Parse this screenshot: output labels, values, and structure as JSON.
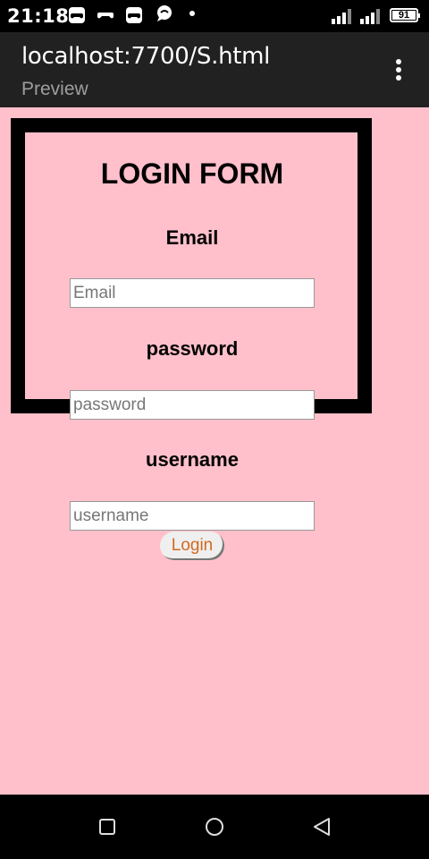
{
  "status_bar": {
    "time": "21:18",
    "icons": [
      "gamepad-icon",
      "gamepad-icon",
      "gamepad-icon",
      "chat-bubble-icon",
      "dot-icon"
    ],
    "battery": "91"
  },
  "app_bar": {
    "title": "localhost:7700/S.html",
    "subtitle": "Preview"
  },
  "form": {
    "title": "LOGIN FORM",
    "email_label": "Email",
    "email_placeholder": "Email",
    "password_label": "password",
    "password_placeholder": "password",
    "username_label": "username",
    "username_placeholder": "username",
    "login_label": "Login"
  },
  "colors": {
    "page_background": "#ffc0cb",
    "box_border": "#000000",
    "button_text": "#d2691e",
    "app_bar": "#212121"
  },
  "nav_bar": {
    "icons": [
      "square-icon",
      "circle-icon",
      "triangle-back-icon"
    ]
  }
}
